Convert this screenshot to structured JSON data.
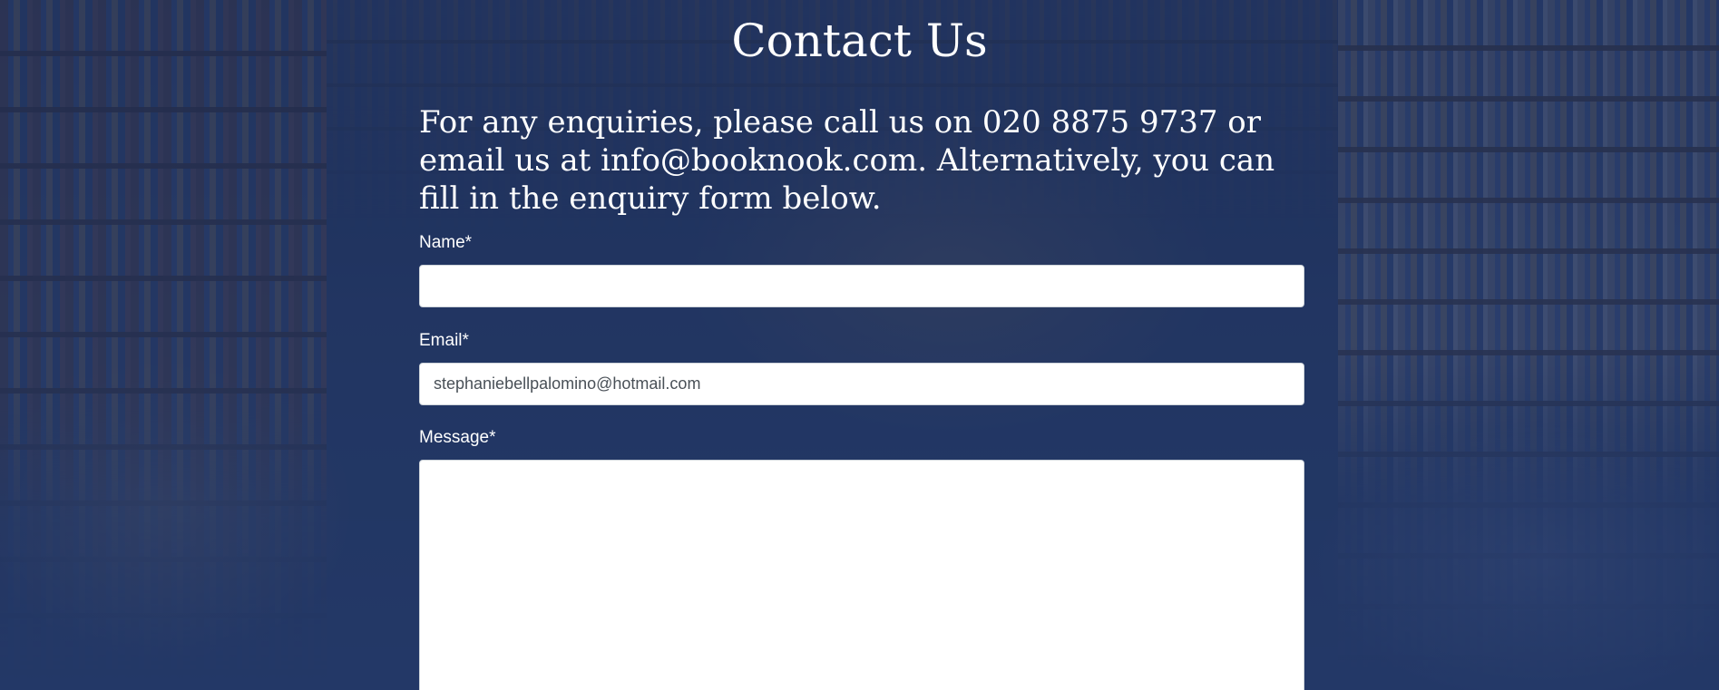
{
  "page": {
    "title": "Contact Us",
    "intro": "For any enquiries, please call us on 020 8875 9737 or email us at info@booknook.com. Alternatively, you can fill in the enquiry form below."
  },
  "form": {
    "name": {
      "label": "Name*",
      "value": "",
      "placeholder": ""
    },
    "email": {
      "label": "Email*",
      "value": "stephaniebellpalomino@hotmail.com",
      "placeholder": ""
    },
    "message": {
      "label": "Message*",
      "value": "",
      "placeholder": ""
    }
  },
  "colors": {
    "overlay": "#1c305f",
    "text": "#ffffff",
    "field_background": "#ffffff",
    "field_text": "#495057"
  },
  "background": {
    "image": "bookshop-interior"
  }
}
